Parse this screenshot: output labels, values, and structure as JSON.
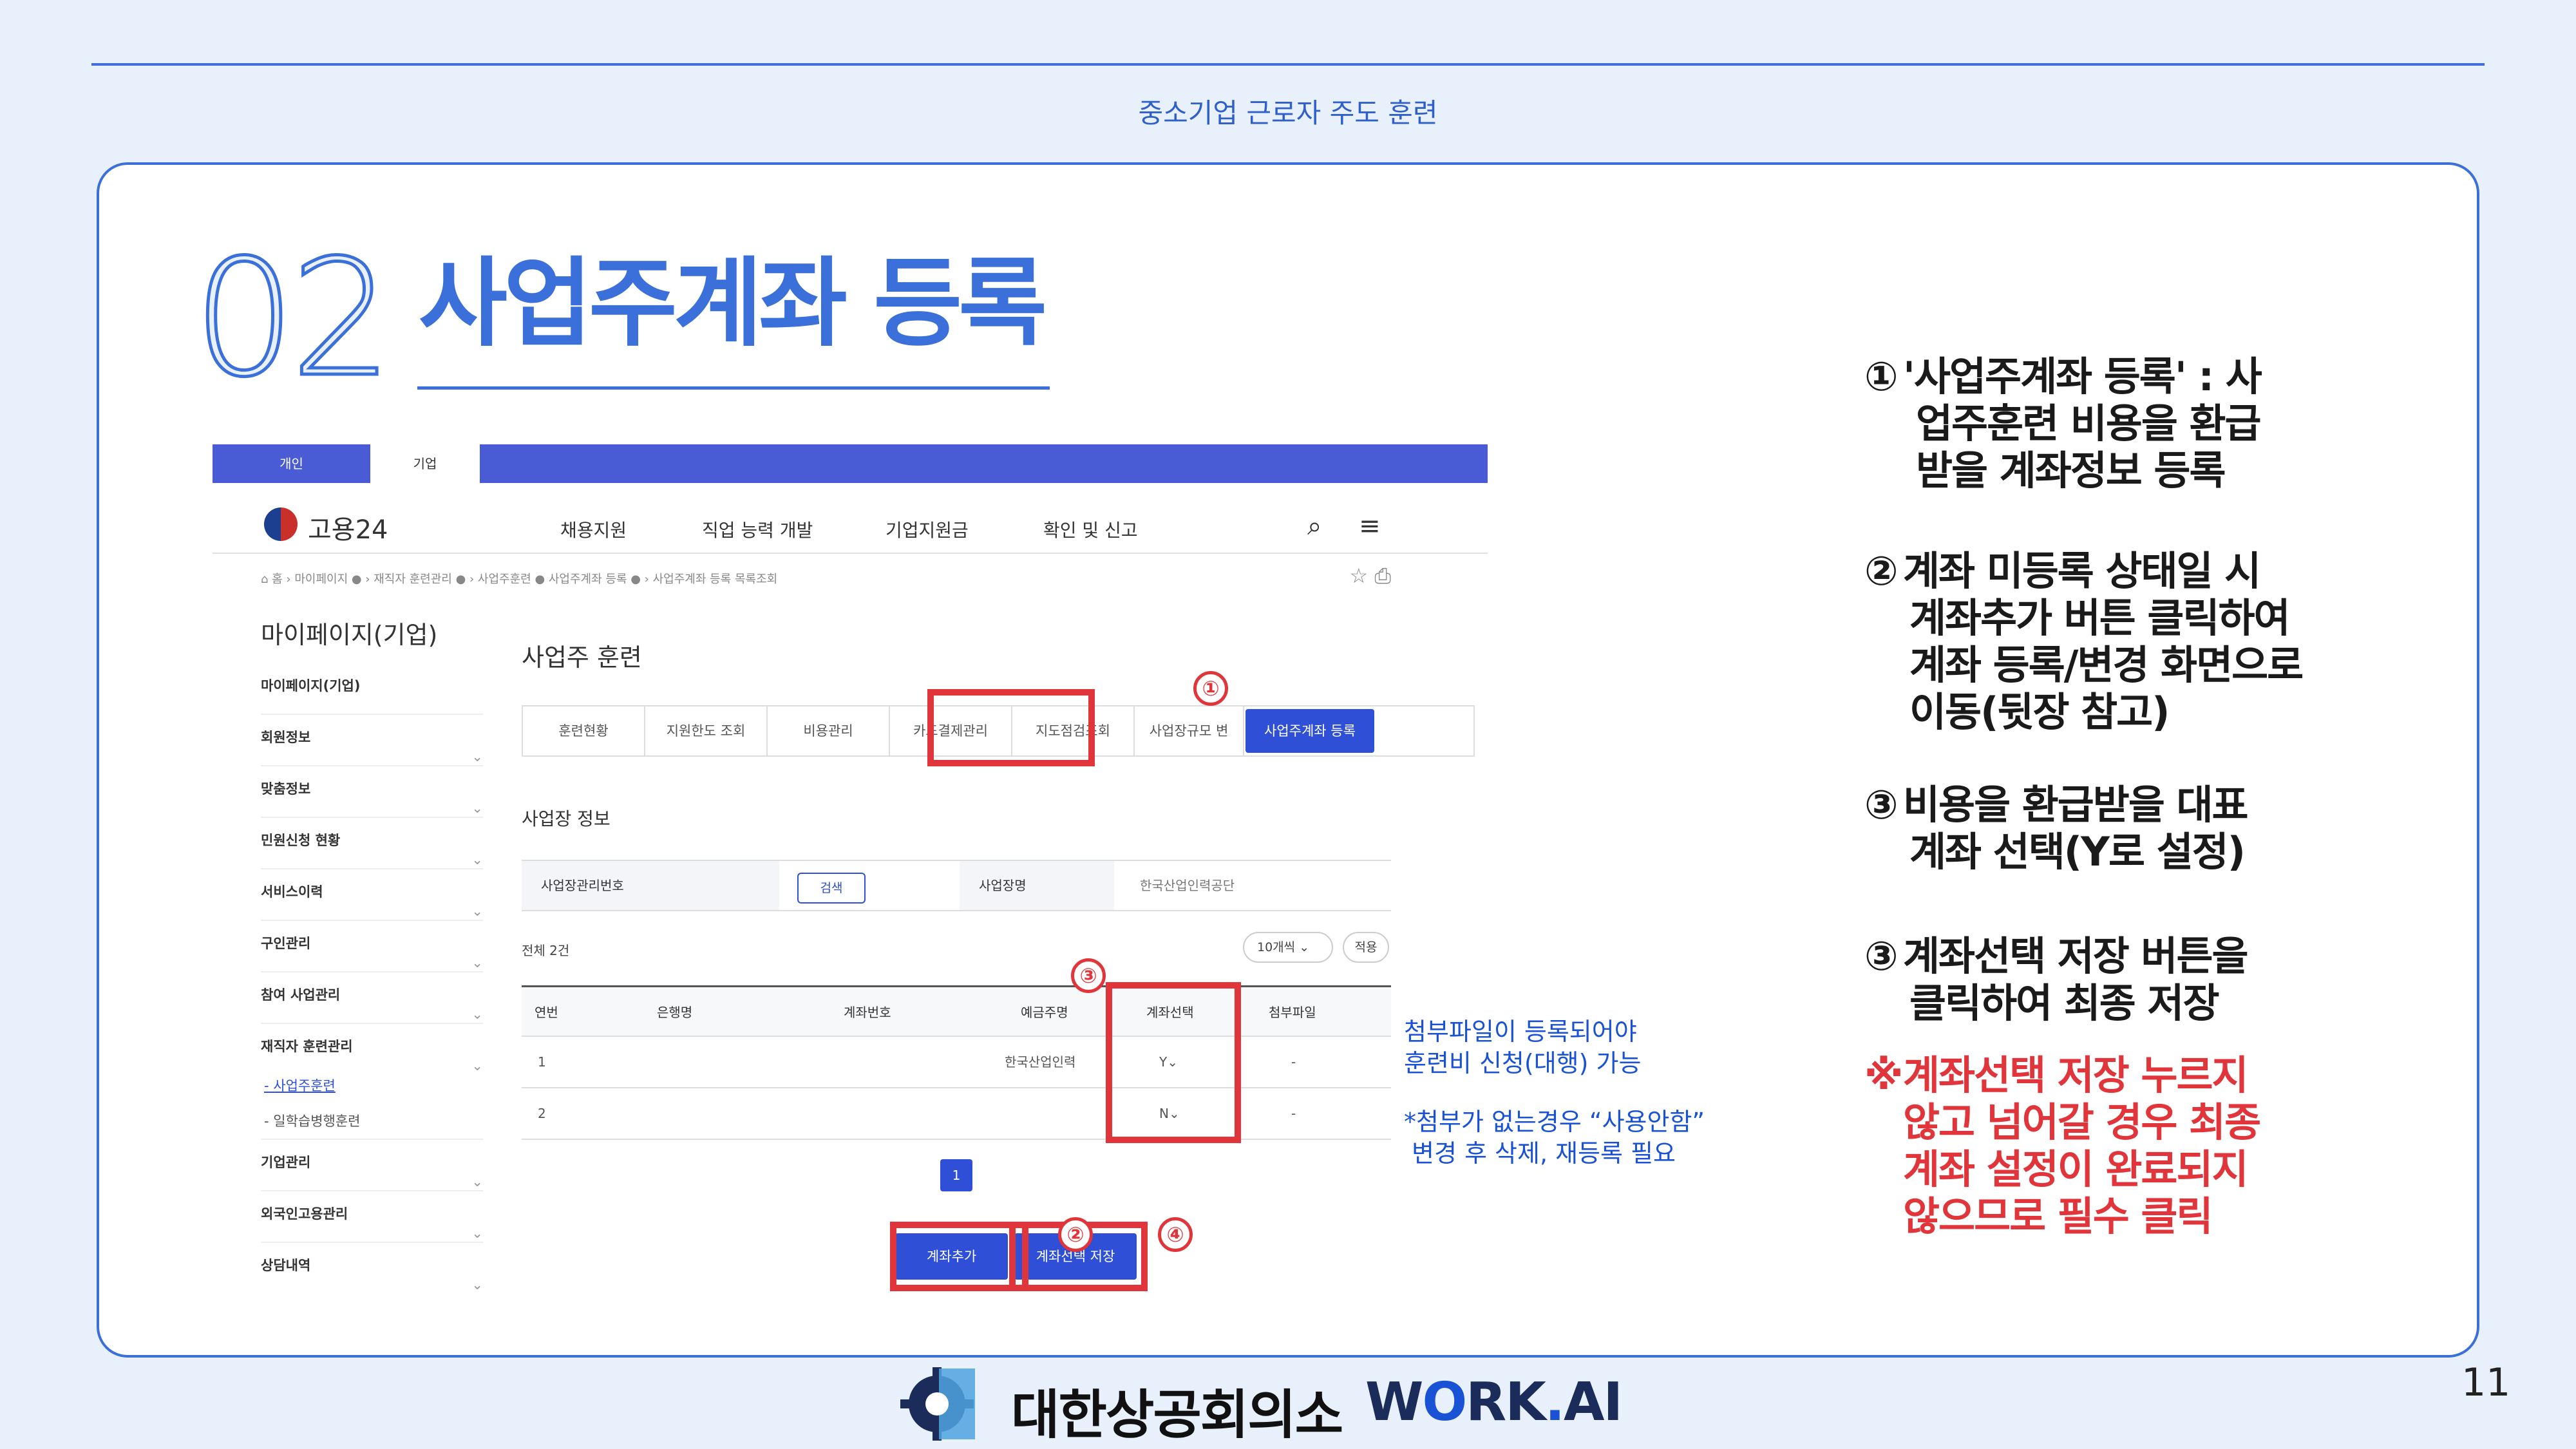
{
  "header": {
    "title": "중소기업 근로자 주도 훈련"
  },
  "section": {
    "number": "02",
    "title": "사업주계좌 등록"
  },
  "screenshot": {
    "top_tabs": {
      "user": "개인",
      "biz": "기업"
    },
    "logo": "고용24",
    "gnb": [
      "채용지원",
      "직업 능력 개발",
      "기업지원금",
      "확인 및 신고"
    ],
    "breadcrumb": "⌂ 홈  ›  마이페이지 ●  ›  재직자 훈련관리 ●  ›  사업주훈련 ● 사업주계좌 등록 ●  ›  사업주계좌 등록 목록조회",
    "sidebar": {
      "title": "마이페이지(기업)",
      "home": "마이페이지(기업)",
      "items": [
        "회원정보",
        "맞춤정보",
        "민원신청 현황",
        "서비스이력",
        "구인관리",
        "참여 사업관리",
        "재직자 훈련관리",
        "기업관리",
        "외국인고용관리",
        "상담내역"
      ],
      "subitems": [
        "- 사업주훈련",
        "- 일학습병행훈련"
      ]
    },
    "main_title": "사업주 훈련",
    "subtabs": [
      "훈련현황",
      "지원한도 조회",
      "비용관리",
      "카드결제관리",
      "지도점검조회",
      "사업장규모 변"
    ],
    "active_tab": "사업주계좌 등록",
    "site_info_title": "사업장 정보",
    "info": {
      "label1": "사업장관리번호",
      "search": "검색",
      "label2": "사업장명",
      "value2": "한국산업인력공단"
    },
    "count": "전체 2건",
    "perpage": "10개씩",
    "view": "적용",
    "table": {
      "headers": [
        "연번",
        "은행명",
        "계좌번호",
        "예금주명",
        "계좌선택",
        "첨부파일"
      ],
      "rows": [
        [
          "1",
          "",
          "",
          "한국산업인력",
          "Y",
          "-"
        ],
        [
          "2",
          "",
          "",
          "",
          "N",
          "-"
        ]
      ]
    },
    "page": "1",
    "buttons": {
      "add": "계좌추가",
      "save": "계좌선택 저장"
    },
    "markers": [
      "①",
      "②",
      "③",
      "④"
    ]
  },
  "notes": {
    "attach": [
      "첨부파일이 등록되어야",
      "훈련비 신청(대행) 가능"
    ],
    "noattach": [
      "*첨부가 없는경우 “사용안함”",
      "변경 후 삭제, 재등록 필요"
    ]
  },
  "steps": [
    {
      "mark": "①",
      "lines": [
        "'사업주계좌 등록' : 사",
        "업주훈련 비용을 환급",
        "받을 계좌정보 등록"
      ]
    },
    {
      "mark": "②",
      "lines": [
        "계좌 미등록 상태일 시",
        "계좌추가 버튼 클릭하여",
        "계좌 등록/변경 화면으로",
        "이동(뒷장 참고)"
      ]
    },
    {
      "mark": "③",
      "lines": [
        "비용을 환급받을 대표",
        "계좌 선택(Y로 설정)"
      ]
    },
    {
      "mark": "③",
      "lines": [
        "계좌선택 저장 버튼을",
        "클릭하여 최종 저장"
      ]
    },
    {
      "mark": "※",
      "lines": [
        "계좌선택 저장 누르지",
        "않고 넘어갈 경우 최종",
        "계좌 설정이 완료되지",
        "않으므로 필수 클릭"
      ]
    }
  ],
  "footer": {
    "org": "대한상공회의소",
    "work_w": "W",
    "work_o": "O",
    "work_rk": "RK",
    "work_dot": ".",
    "work_ai": "AI"
  },
  "page_number": "11",
  "colors": {
    "accent": "#3b6fd9",
    "red": "#e0363b",
    "bg": "#e8f0fb"
  }
}
